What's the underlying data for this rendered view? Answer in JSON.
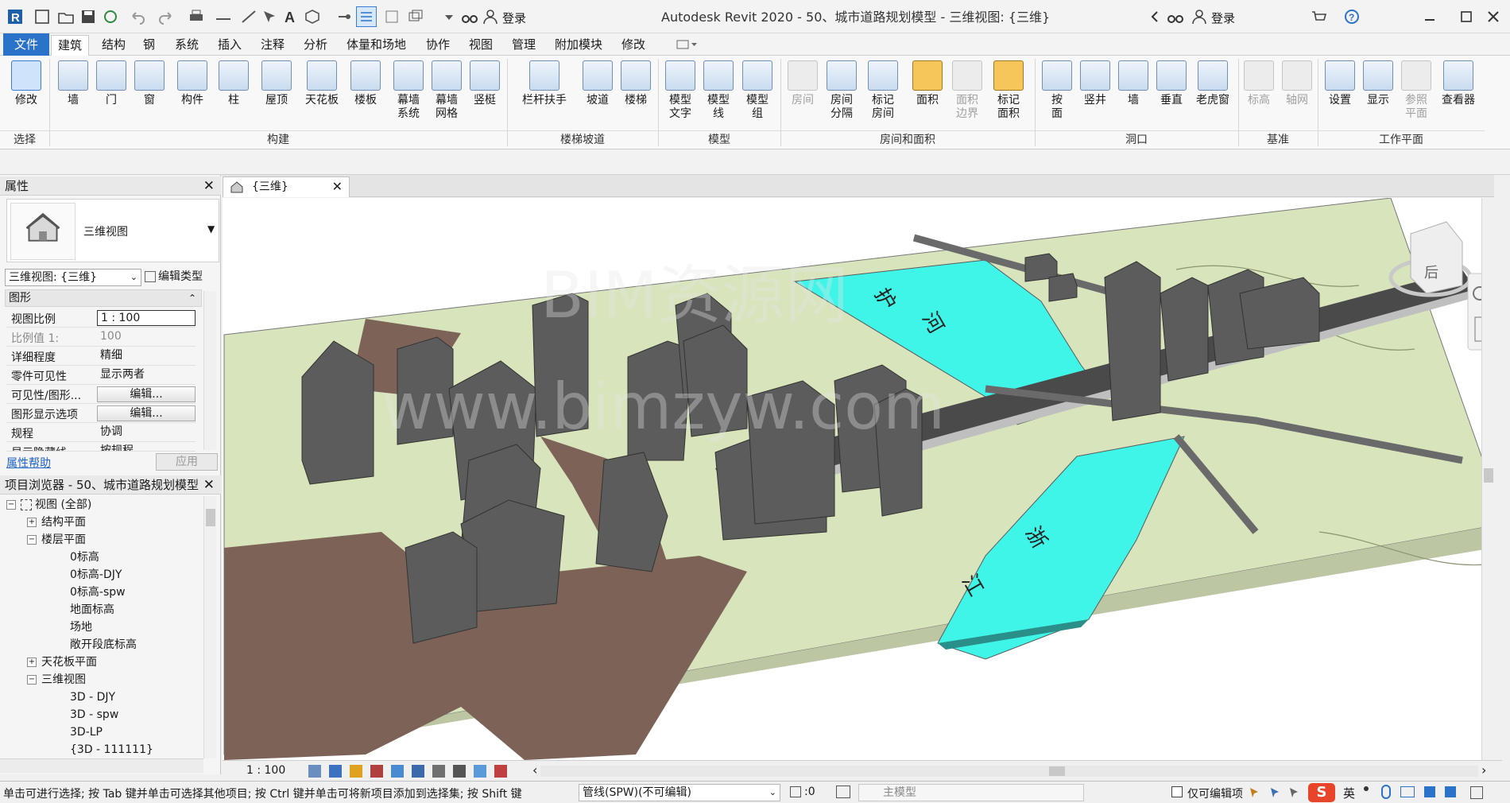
{
  "titlebar": {
    "title": "Autodesk Revit 2020 - 50、城市道路规划模型 - 三维视图: {三维}",
    "login_left": "登录",
    "login_right": "登录"
  },
  "tabs": [
    {
      "label": "文件"
    },
    {
      "label": "建筑"
    },
    {
      "label": "结构"
    },
    {
      "label": "钢"
    },
    {
      "label": "系统"
    },
    {
      "label": "插入"
    },
    {
      "label": "注释"
    },
    {
      "label": "分析"
    },
    {
      "label": "体量和场地"
    },
    {
      "label": "协作"
    },
    {
      "label": "视图"
    },
    {
      "label": "管理"
    },
    {
      "label": "附加模块"
    },
    {
      "label": "修改"
    }
  ],
  "ribbon": {
    "select_group": "选择",
    "buttons": [
      {
        "label": "修改",
        "sub": ""
      },
      {
        "label": "墙",
        "sub": ""
      },
      {
        "label": "门",
        "sub": ""
      },
      {
        "label": "窗",
        "sub": ""
      },
      {
        "label": "构件",
        "sub": ""
      },
      {
        "label": "柱",
        "sub": ""
      },
      {
        "label": "屋顶",
        "sub": ""
      },
      {
        "label": "天花板",
        "sub": ""
      },
      {
        "label": "楼板",
        "sub": ""
      },
      {
        "label": "幕墙",
        "sub": "系统"
      },
      {
        "label": "幕墙",
        "sub": "网格"
      },
      {
        "label": "竖梃",
        "sub": ""
      },
      {
        "label": "栏杆扶手",
        "sub": ""
      },
      {
        "label": "坡道",
        "sub": ""
      },
      {
        "label": "楼梯",
        "sub": ""
      },
      {
        "label": "模型",
        "sub": "文字"
      },
      {
        "label": "模型",
        "sub": "线"
      },
      {
        "label": "模型",
        "sub": "组"
      },
      {
        "label": "房间",
        "sub": ""
      },
      {
        "label": "房间",
        "sub": "分隔"
      },
      {
        "label": "标记",
        "sub": "房间"
      },
      {
        "label": "面积",
        "sub": ""
      },
      {
        "label": "面积",
        "sub": "边界"
      },
      {
        "label": "标记",
        "sub": "面积"
      },
      {
        "label": "按",
        "sub": "面"
      },
      {
        "label": "竖井",
        "sub": ""
      },
      {
        "label": "墙",
        "sub": ""
      },
      {
        "label": "垂直",
        "sub": ""
      },
      {
        "label": "老虎窗",
        "sub": ""
      },
      {
        "label": "标高",
        "sub": ""
      },
      {
        "label": "轴网",
        "sub": ""
      },
      {
        "label": "设置",
        "sub": ""
      },
      {
        "label": "显示",
        "sub": ""
      },
      {
        "label": "参照",
        "sub": "平面"
      },
      {
        "label": "查看器",
        "sub": ""
      }
    ],
    "groups": [
      "构建",
      "楼梯坡道",
      "模型",
      "房间和面积",
      "洞口",
      "基准",
      "工作平面"
    ]
  },
  "properties": {
    "title": "属性",
    "type_name": "三维视图",
    "view_selector": "三维视图: {三维}",
    "edit_type": "编辑类型",
    "section": "图形",
    "rows": [
      {
        "k": "视图比例",
        "v": "1 : 100"
      },
      {
        "k": "比例值 1:",
        "v": "100"
      },
      {
        "k": "详细程度",
        "v": "精细"
      },
      {
        "k": "零件可见性",
        "v": "显示两者"
      },
      {
        "k": "可见性/图形...",
        "v": "编辑..."
      },
      {
        "k": "图形显示选项",
        "v": "编辑..."
      },
      {
        "k": "规程",
        "v": "协调"
      },
      {
        "k": "显示隐藏线",
        "v": "按规程"
      }
    ],
    "help": "属性帮助",
    "apply": "应用"
  },
  "browser": {
    "title": "项目浏览器 - 50、城市道路规划模型",
    "items": [
      {
        "label": "视图 (全部)",
        "level": 0,
        "exp": "-"
      },
      {
        "label": "结构平面",
        "level": 1,
        "exp": "+"
      },
      {
        "label": "楼层平面",
        "level": 1,
        "exp": "-"
      },
      {
        "label": "0标高",
        "level": 2,
        "exp": ""
      },
      {
        "label": "0标高-DJY",
        "level": 2,
        "exp": ""
      },
      {
        "label": "0标高-spw",
        "level": 2,
        "exp": ""
      },
      {
        "label": "地面标高",
        "level": 2,
        "exp": ""
      },
      {
        "label": "场地",
        "level": 2,
        "exp": ""
      },
      {
        "label": "敞开段底标高",
        "level": 2,
        "exp": ""
      },
      {
        "label": "天花板平面",
        "level": 1,
        "exp": "+"
      },
      {
        "label": "三维视图",
        "level": 1,
        "exp": "-"
      },
      {
        "label": "3D - DJY",
        "level": 2,
        "exp": ""
      },
      {
        "label": "3D - spw",
        "level": 2,
        "exp": ""
      },
      {
        "label": "3D-LP",
        "level": 2,
        "exp": ""
      },
      {
        "label": "{3D - 111111}",
        "level": 2,
        "exp": ""
      }
    ]
  },
  "view": {
    "tab_label": "{三维}",
    "scale": "1 : 100",
    "viewcube_label": "后",
    "watermark1": "BIM资源网",
    "watermark2": "www.bimzyw.com",
    "river_labels": [
      "护",
      "河",
      "浙",
      "江"
    ]
  },
  "status": {
    "hint": "单击可进行选择; 按 Tab 键并单击可选择其他项目; 按 Ctrl 键并单击可将新项目添加到选择集; 按 Shift 键",
    "workset": "管线(SPW)(不可编辑)",
    "filter_count": ":0",
    "model": "主模型",
    "editable_only": "仅可编辑项",
    "ime": "英"
  },
  "colors": {
    "accent": "#2b72c9",
    "water": "#3ff5e8",
    "ground": "#d8e4bb",
    "road": "#7d6357",
    "building": "#5c5c5c"
  }
}
